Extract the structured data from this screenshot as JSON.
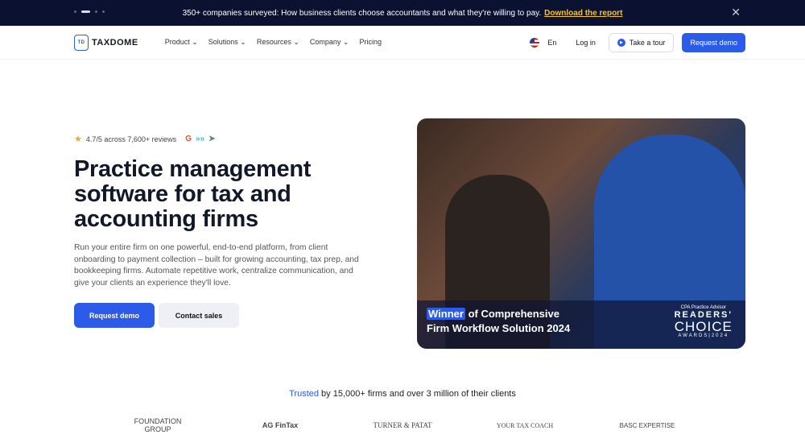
{
  "banner": {
    "text": "350+ companies surveyed: How business clients choose accountants and what they're willing to pay.",
    "link": "Download the report"
  },
  "nav": {
    "logo": "TAXDOME",
    "logo_mark": "TD",
    "items": [
      "Product ⌄",
      "Solutions ⌄",
      "Resources ⌄",
      "Company ⌄",
      "Pricing"
    ],
    "lang": "En",
    "login": "Log in",
    "tour": "Take a tour",
    "demo": "Request demo"
  },
  "hero": {
    "rating": "4.7/5 across 7,600+ reviews",
    "title": "Practice management software for tax and accounting firms",
    "description": "Run your entire firm on one powerful, end-to-end platform, from client onboarding to payment collection – built for growing accounting, tax prep, and bookkeeping firms. Automate repetitive work, centralize communication, and give your clients an experience they'll love.",
    "cta_primary": "Request demo",
    "cta_secondary": "Contact sales"
  },
  "media": {
    "highlight": "Winner",
    "caption1": " of Comprehensive",
    "caption2": "Firm Workflow Solution 2024",
    "award_source": "CPA Practice Advisor",
    "award_line1": "READERS'",
    "award_line2": "CHOICE",
    "award_line3": "AWARDS|2024"
  },
  "trusted": {
    "highlight": "Trusted",
    "text": " by 15,000+ firms and over 3 million of their clients"
  },
  "logos": [
    "FOUNDATION GROUP",
    "AG FinTax",
    "TURNER & PATAT",
    "YOUR TAX COACH",
    "BASC EXPERTISE"
  ]
}
